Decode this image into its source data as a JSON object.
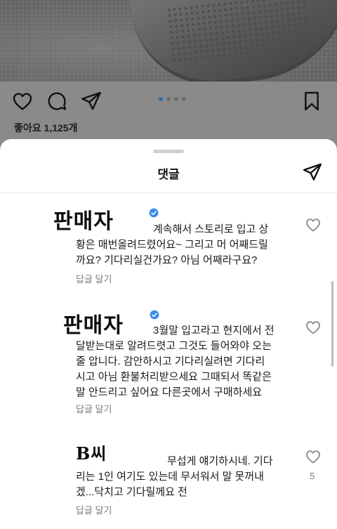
{
  "post": {
    "likes_text": "좋아요 1,125개"
  },
  "sheet": {
    "title": "댓글"
  },
  "comments": [
    {
      "author_handwritten": "판매자",
      "text": "계속해서 스토리로 입고 상\n황은 매번올려드렸어요~ 그리고 머 어째드릴\n까요? 기다리실건가요? 아님 어째라구요?",
      "reply_label": "답글 달기",
      "verified": true
    },
    {
      "author_handwritten": "판매자",
      "text": "3월말 입고라고 현지에서 전\n달받는대로 알려드렷고 그것도 들어와야 오는\n줄 압니다. 감안하시고 기다리실려면 기다리\n시고 아님 환불처리받으세요 그때되서 똑같은\n말 안드리고 싶어요 다른곳에서 구매하세요",
      "reply_label": "답글 달기",
      "verified": true
    },
    {
      "author_handwritten": "B씨",
      "text": "무섭게 얘기하시네. 기다\n리는 1인 여기도 있는데 무서워서 말 못꺼내\n겠...닥치고 기다릴께요 전",
      "reply_label": "답글 달기",
      "like_count": "5",
      "verified": false
    }
  ],
  "colors": {
    "verified": "#3b8bea",
    "active_dot": "#2f6fa8"
  },
  "icons": [
    "heart-icon",
    "comment-icon",
    "send-icon",
    "bookmark-icon",
    "verified-badge-icon",
    "share-icon"
  ]
}
